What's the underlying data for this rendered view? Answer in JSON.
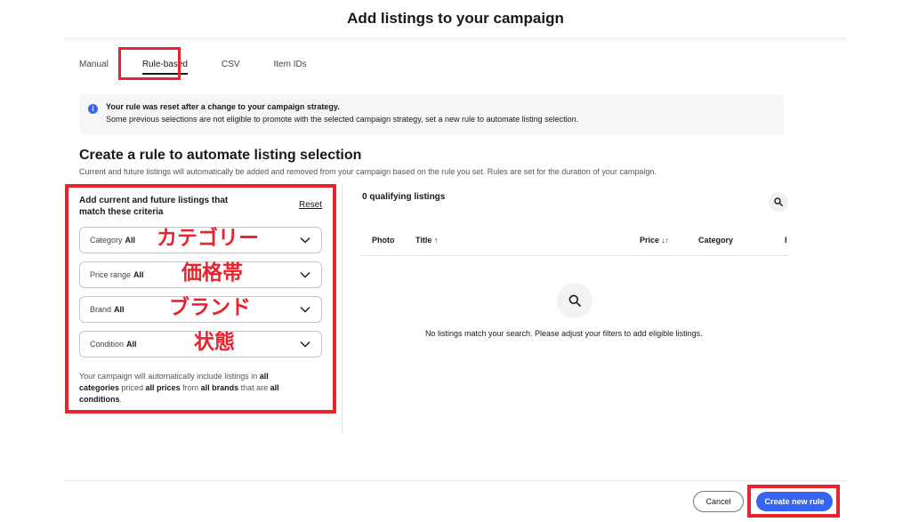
{
  "header": {
    "title": "Add listings to your campaign"
  },
  "tabs": [
    {
      "label": "Manual",
      "active": false
    },
    {
      "label": "Rule-based",
      "active": true
    },
    {
      "label": "CSV",
      "active": false
    },
    {
      "label": "Item IDs",
      "active": false
    }
  ],
  "alert": {
    "title": "Your rule was reset after a change to your campaign strategy.",
    "body": "Some previous selections are not eligible to promote with the selected campaign strategy, set a new rule to automate listing selection."
  },
  "section": {
    "title": "Create a rule to automate listing selection",
    "subtitle": "Current and future listings will automatically be added and removed from your campaign based on the rule you set. Rules are set for the duration of your campaign."
  },
  "criteria": {
    "title": "Add current and future listings that match these criteria",
    "reset_label": "Reset",
    "filters": [
      {
        "label": "Category",
        "value": "All",
        "annotation": "カテゴリー"
      },
      {
        "label": "Price range",
        "value": "All",
        "annotation": "価格帯"
      },
      {
        "label": "Brand",
        "value": "All",
        "annotation": "ブランド"
      },
      {
        "label": "Condition",
        "value": "All",
        "annotation": "状態"
      }
    ],
    "summary": {
      "p1": "Your campaign will automatically include listings in ",
      "b1": "all categories",
      "p2": " priced ",
      "b2": "all prices",
      "p3": " from ",
      "b3": "all brands",
      "p4": " that are ",
      "b4": "all conditions",
      "p5": "."
    }
  },
  "results": {
    "count_label": "0 qualifying listings",
    "columns": {
      "photo": "Photo",
      "title": "Title",
      "price": "Price",
      "category": "Category",
      "truncated": "I"
    },
    "empty_message": "No listings match your search. Please adjust your filters to add eligible listings."
  },
  "footer": {
    "cancel_label": "Cancel",
    "create_label": "Create new rule"
  },
  "colors": {
    "accent": "#3665f3",
    "highlight": "#e8232e"
  }
}
